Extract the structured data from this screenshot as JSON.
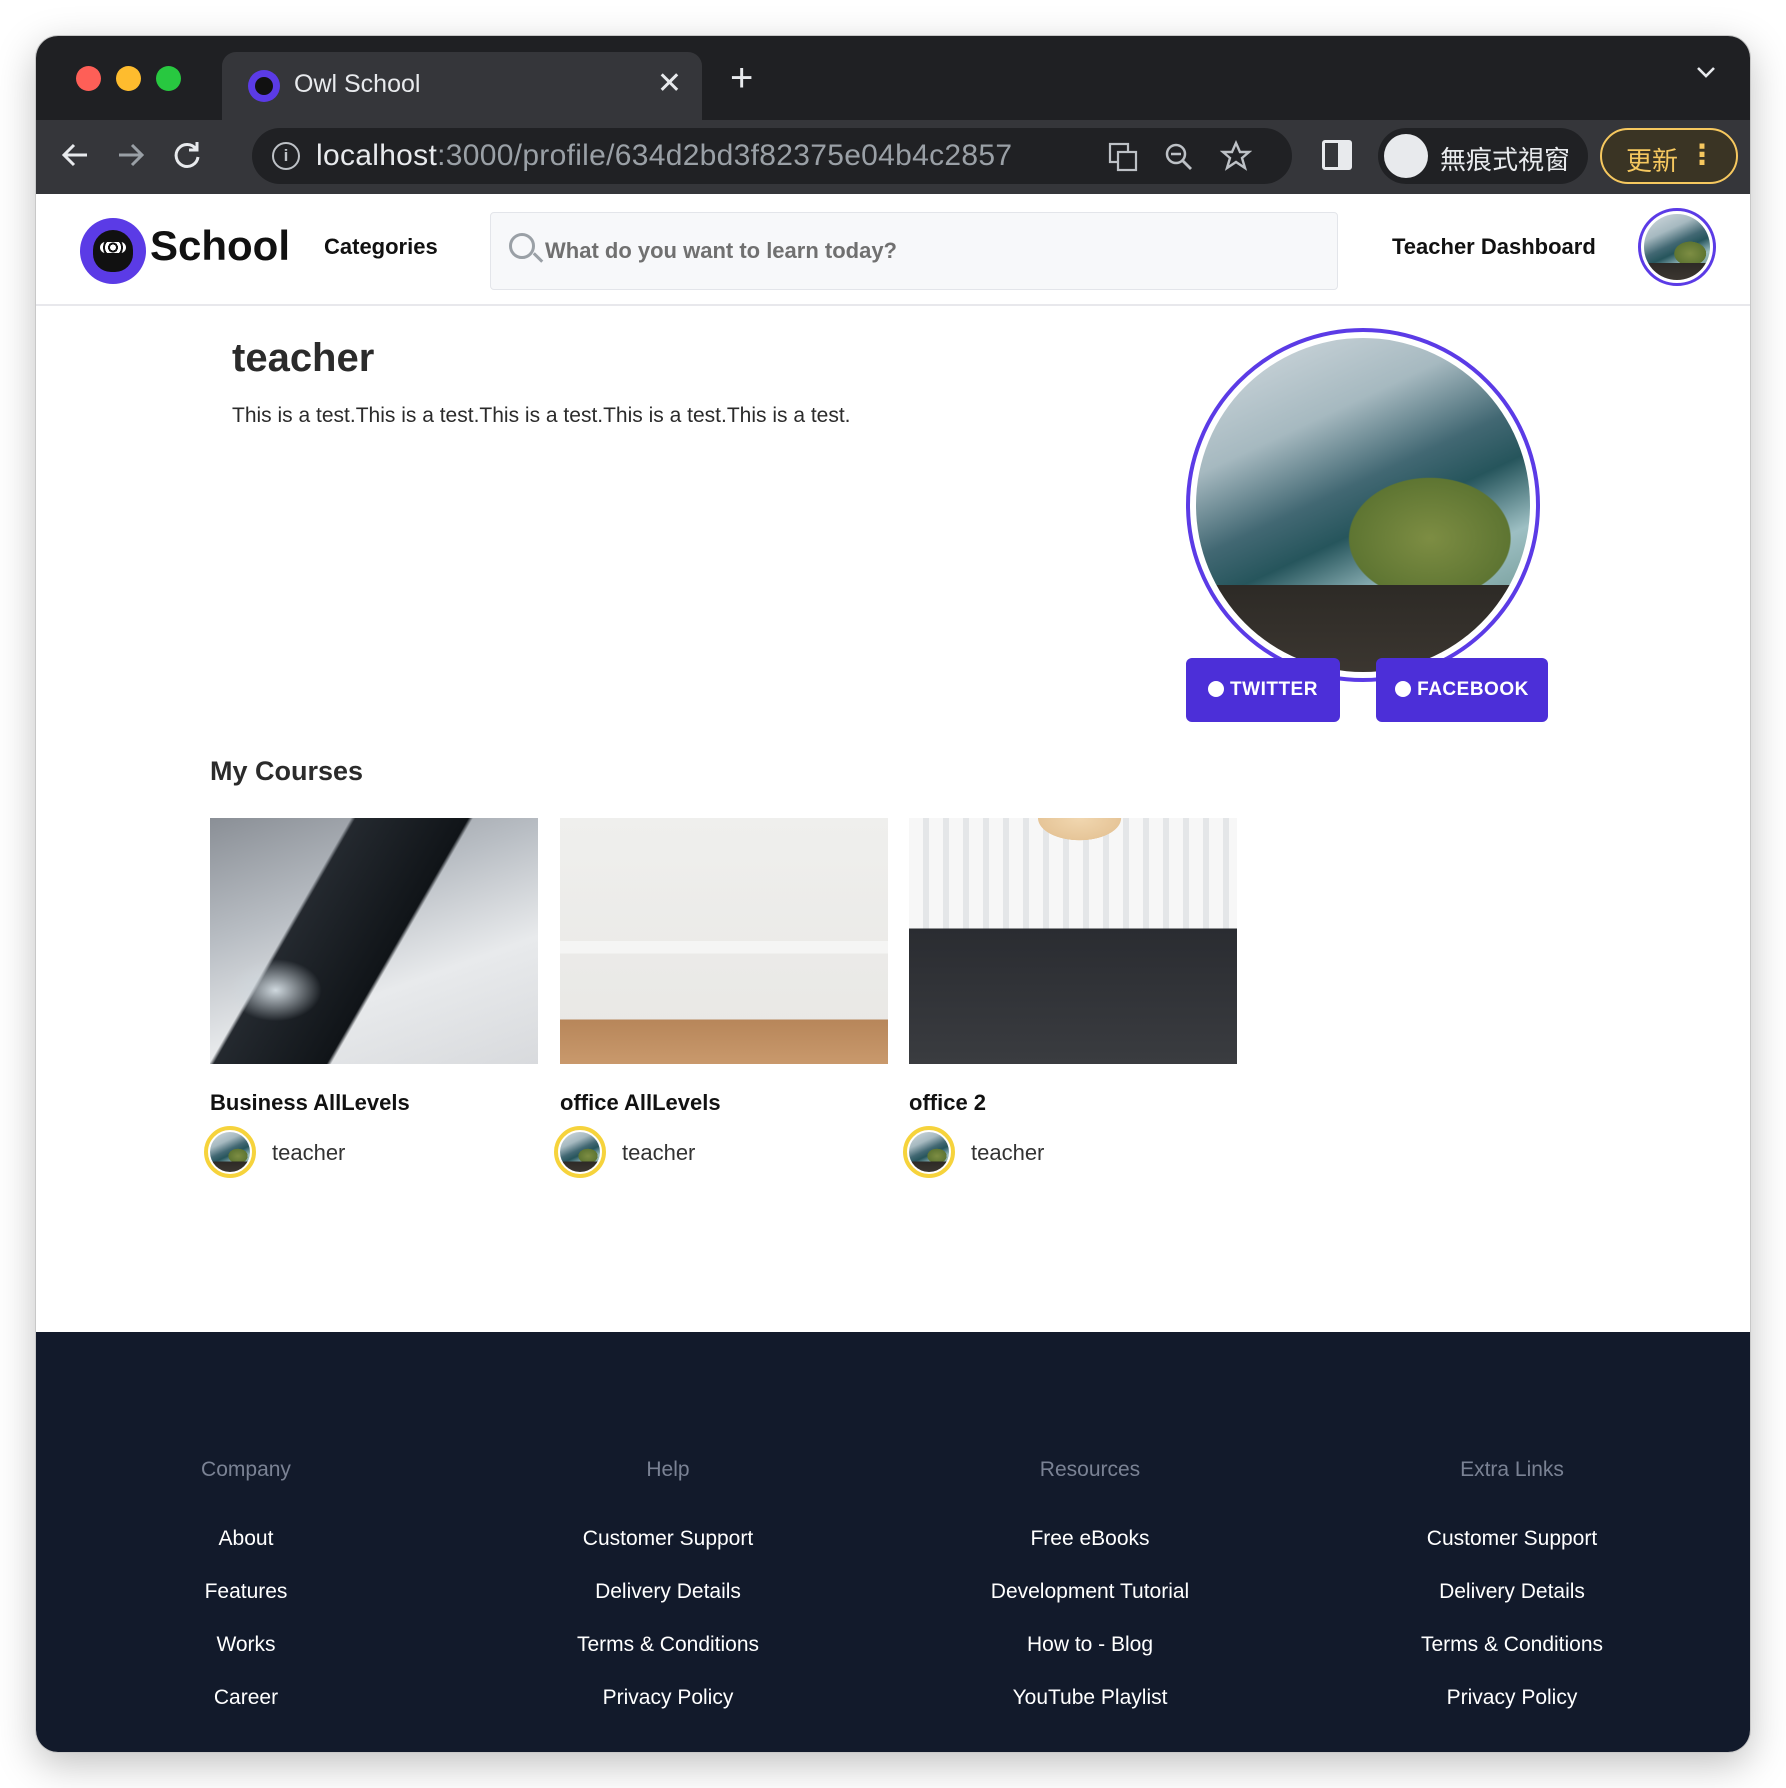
{
  "browser": {
    "tab_title": "Owl School",
    "close_glyph": "✕",
    "newtab_glyph": "+",
    "url_host": "localhost",
    "url_path": ":3000/profile/634d2bd3f82375e04b4c2857",
    "incognito_label": "無痕式視窗",
    "update_label": "更新"
  },
  "header": {
    "logo_text": "School",
    "categories_label": "Categories",
    "search_placeholder": "What do you want to learn today?",
    "dashboard_label": "Teacher Dashboard"
  },
  "profile": {
    "name": "teacher",
    "bio": "This is a test.This is a test.This is a test.This is a test.This is a test.",
    "twitter_label": "TWITTER",
    "facebook_label": "FACEBOOK",
    "accent_color": "#4c2fd8"
  },
  "courses": {
    "section_title": "My Courses",
    "items": [
      {
        "title": "Business AllLevels",
        "author": "teacher"
      },
      {
        "title": "office AllLevels",
        "author": "teacher"
      },
      {
        "title": "office 2",
        "author": "teacher"
      }
    ]
  },
  "footer": {
    "columns": [
      {
        "title": "Company",
        "links": [
          "About",
          "Features",
          "Works",
          "Career"
        ]
      },
      {
        "title": "Help",
        "links": [
          "Customer Support",
          "Delivery Details",
          "Terms & Conditions",
          "Privacy Policy"
        ]
      },
      {
        "title": "Resources",
        "links": [
          "Free eBooks",
          "Development Tutorial",
          "How to - Blog",
          "YouTube Playlist"
        ]
      },
      {
        "title": "Extra Links",
        "links": [
          "Customer Support",
          "Delivery Details",
          "Terms & Conditions",
          "Privacy Policy"
        ]
      }
    ]
  }
}
